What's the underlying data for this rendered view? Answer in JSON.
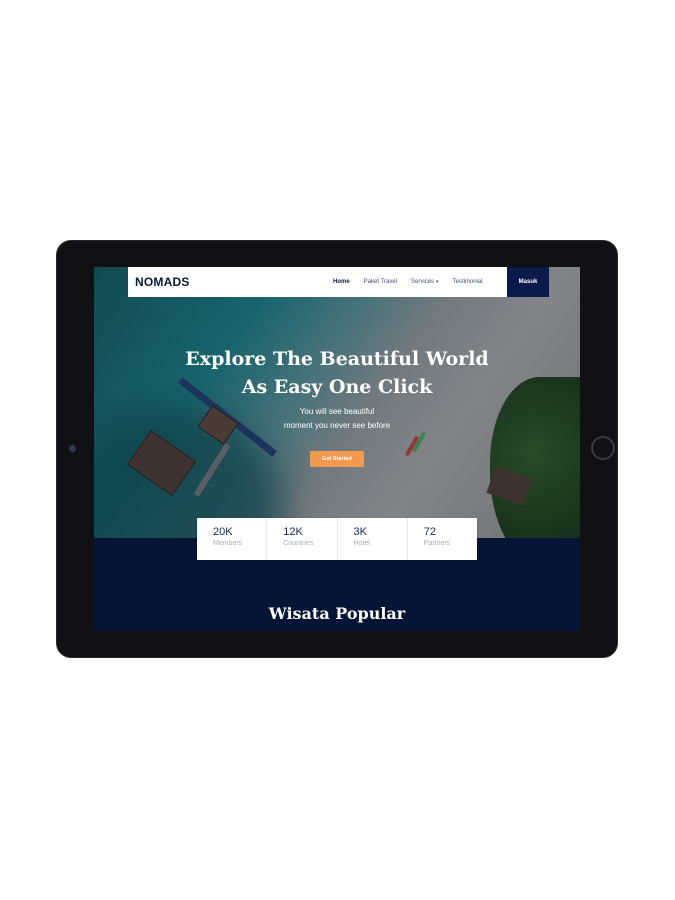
{
  "brand": {
    "logo": "NOMADS"
  },
  "nav": {
    "links": [
      "Home",
      "Paket Travel",
      "Services",
      "Testimonial"
    ],
    "caret": "▾",
    "login": "Masuk"
  },
  "hero": {
    "title_line1": "Explore The Beautiful World",
    "title_line2": "As Easy One Click",
    "subtitle_line1": "You will see beautiful",
    "subtitle_line2": "moment you never see before",
    "cta": "Get Started"
  },
  "stats": [
    {
      "value": "20K",
      "label": "Members"
    },
    {
      "value": "12K",
      "label": "Countries"
    },
    {
      "value": "3K",
      "label": "Hotel"
    },
    {
      "value": "72",
      "label": "Partners"
    }
  ],
  "section": {
    "title": "Wisata Popular",
    "subtitle": ""
  },
  "colors": {
    "navy": "#0b1a4a",
    "accent": "#f29a50",
    "section_bg": "#061436"
  }
}
